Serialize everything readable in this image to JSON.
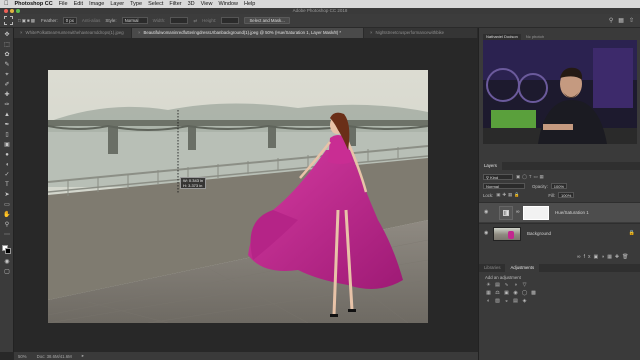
{
  "menubar": {
    "app_name": "Photoshop CC",
    "items": [
      "File",
      "Edit",
      "Image",
      "Layer",
      "Type",
      "Select",
      "Filter",
      "3D",
      "View",
      "Window",
      "Help"
    ]
  },
  "window": {
    "title": "Adobe Photoshop CC 2018"
  },
  "options": {
    "feather_label": "Feather:",
    "feather_value": "0 px",
    "antialias_label": "Anti-alias",
    "style_label": "Style:",
    "style_value": "Normal",
    "width_label": "Width:",
    "height_label": "Height:",
    "select_mask_label": "Select and Mask..."
  },
  "tabs": [
    {
      "label": "WhitePolkaBearHunterwithehavtearnddrops(1).jpeg",
      "active": false
    },
    {
      "label": "BeautifulwomaninredfutteringdressUrbanbackground(1).jpeg @ 50% (Hue/Saturation 1, Layer Mask/8) *",
      "active": true
    },
    {
      "label": "Nightstreetcrusperformancewithbike",
      "active": false
    }
  ],
  "measure": {
    "w_line": "W: 0.343 in",
    "h_line": "H: 3.373 in"
  },
  "status": {
    "zoom": "50%",
    "doc": "Doc: 38.6M/41.6M"
  },
  "webcam_tabs": [
    "Nathaniel Dodson",
    "Nc photoh"
  ],
  "layers": {
    "panel_tabs": [
      "Layers"
    ],
    "kind_label": "Kind",
    "blend_mode": "Normal",
    "opacity_label": "Opacity:",
    "opacity_value": "100%",
    "lock_label": "Lock:",
    "fill_label": "Fill:",
    "fill_value": "100%",
    "items": [
      {
        "name": "Hue/Saturation 1",
        "selected": true
      },
      {
        "name": "Background",
        "selected": false
      }
    ]
  },
  "adjustments": {
    "tabs": [
      "Libraries",
      "Adjustments"
    ],
    "add_label": "Add an adjustment"
  },
  "colors": {
    "accent_dress": "#c2288f",
    "sky": "#d8dbd2",
    "webcam_purple": "#3b2a6a"
  }
}
